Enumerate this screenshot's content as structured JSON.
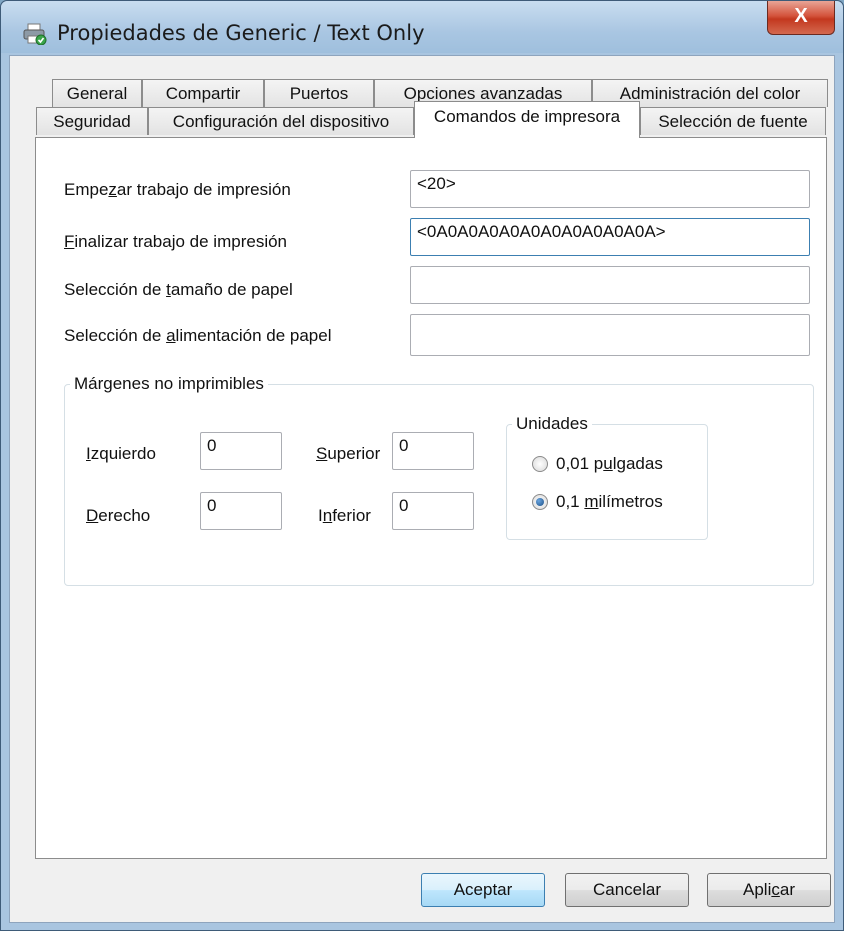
{
  "window": {
    "title": "Propiedades de Generic / Text Only",
    "icon": "printer-icon",
    "close_label": "X"
  },
  "tabs_row1": [
    {
      "label": "General"
    },
    {
      "label": "Compartir"
    },
    {
      "label": "Puertos"
    },
    {
      "label": "Opciones avanzadas"
    },
    {
      "label": "Administración del color"
    }
  ],
  "tabs_row2": [
    {
      "label": "Seguridad"
    },
    {
      "label": "Configuración del dispositivo"
    },
    {
      "label": "Comandos de impresora",
      "active": true
    },
    {
      "label": "Selección de fuente"
    }
  ],
  "fields": {
    "start_job": {
      "label_pre": "Empe",
      "label_key": "z",
      "label_post": "ar trabajo de impresión",
      "value": "<20>"
    },
    "end_job": {
      "label_pre": "",
      "label_key": "F",
      "label_post": "inalizar trabajo de impresión",
      "value": "<0A0A0A0A0A0A0A0A0A0A0A>"
    },
    "paper_size": {
      "label_pre": "Selección de ",
      "label_key": "t",
      "label_post": "amaño de papel",
      "value": ""
    },
    "paper_feed": {
      "label_pre": "Selección de ",
      "label_key": "a",
      "label_post": "limentación de papel",
      "value": ""
    }
  },
  "margins": {
    "title": "Márgenes no imprimibles",
    "left": {
      "label_key": "I",
      "label_post": "zquierdo",
      "value": "0"
    },
    "right": {
      "label_key": "D",
      "label_post": "erecho",
      "value": "0"
    },
    "top": {
      "label_key": "S",
      "label_post": "uperior",
      "value": "0"
    },
    "bottom": {
      "label_pre": "I",
      "label_key": "n",
      "label_post": "ferior",
      "value": "0"
    }
  },
  "units": {
    "title": "Unidades",
    "inches": {
      "label_pre": "0,01 p",
      "label_key": "u",
      "label_post": "lgadas",
      "checked": false
    },
    "mm": {
      "label_pre": "0,1 ",
      "label_key": "m",
      "label_post": "ilímetros",
      "checked": true
    }
  },
  "buttons": {
    "ok": "Aceptar",
    "cancel": "Cancelar",
    "apply_pre": "Apli",
    "apply_key": "c",
    "apply_post": "ar"
  }
}
